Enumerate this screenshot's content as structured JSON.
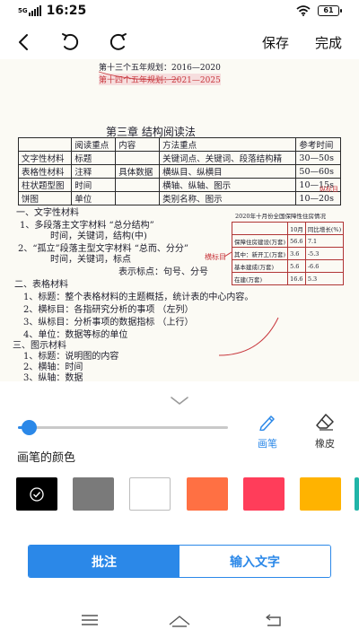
{
  "status_bar": {
    "network": "5G",
    "time": "16:25",
    "battery": "61"
  },
  "toolbar": {
    "save_label": "保存",
    "done_label": "完成"
  },
  "note": {
    "header_line1": "第十三个五年规划：2016—2020",
    "header_line2": "第十四个五年规划：2021—2025",
    "chapter_title": "第三章  结构阅读法",
    "table": {
      "headers": [
        "",
        "阅读重点",
        "内容",
        "方法重点",
        "参考时间"
      ],
      "rows": [
        [
          "文字性材料",
          "标题",
          "",
          "关键词点、关键词、段落结构精",
          "30—50s"
        ],
        [
          "表格性材料",
          "注释",
          "具体数据",
          "横纵目、纵横目",
          "50—60s"
        ],
        [
          "柱状题型图",
          "时间",
          "",
          "横轴、纵轴、图示",
          "10—15s"
        ],
        [
          "饼图",
          "单位",
          "",
          "类别名称、图示",
          "10—20s"
        ]
      ]
    },
    "lines": [
      "一、文字性材料",
      "1、多段落主文字材料        “总分结构”",
      "时间，关键词，结构(中)",
      "2、“孤立”段落主型文字材料   “总而、分分”",
      "时间，关键词，标点",
      "表示标点：句号、分号",
      "二、表格材料",
      "1、标题：整个表格材料的主题概括，统计表的中心内容。",
      "2、横标目：各指研究分析的事项  （左列）",
      "3、纵标目：分析事项的数据指标  （上行）",
      "4、单位：数据等标的单位",
      "三、图示材料",
      "1、标题：说明图的内容",
      "2、横轴：时间",
      "3、纵轴：数据"
    ],
    "side_note": "横标目",
    "side_label": "纵标目",
    "side_table": {
      "title": "2020年十月份全国保障性住房情况",
      "headers": [
        "",
        "10月",
        "同比增长(%)"
      ],
      "rows": [
        [
          "保障住房建设(万套)",
          "56.6",
          "7.1"
        ],
        [
          "其中：新开工(万套)",
          "3.6",
          "-5.3"
        ],
        [
          "基本建成(万套)",
          "5.6",
          "-6.6"
        ],
        [
          "在建(万套)",
          "16.6",
          "5.3"
        ]
      ]
    }
  },
  "panel": {
    "pen_label": "画笔",
    "eraser_label": "橡皮",
    "color_section_label": "画笔的颜色",
    "slider_value": 0.05,
    "colors": [
      "#000000",
      "#7a7a7a",
      "#ffffff",
      "#ff7043",
      "#ff3d5a",
      "#ffb300"
    ],
    "selected_color_index": 0,
    "annotate_label": "批注",
    "input_text_label": "输入文字"
  },
  "accent_color": "#2b88e8",
  "icons": {
    "back": "back-arrow-icon",
    "undo": "undo-icon",
    "redo": "redo-icon",
    "collapse": "chevron-down-icon",
    "pen": "pen-icon",
    "eraser": "eraser-icon",
    "check": "check-icon",
    "nav_menu": "menu-icon",
    "nav_home": "home-icon",
    "nav_back": "return-icon"
  }
}
